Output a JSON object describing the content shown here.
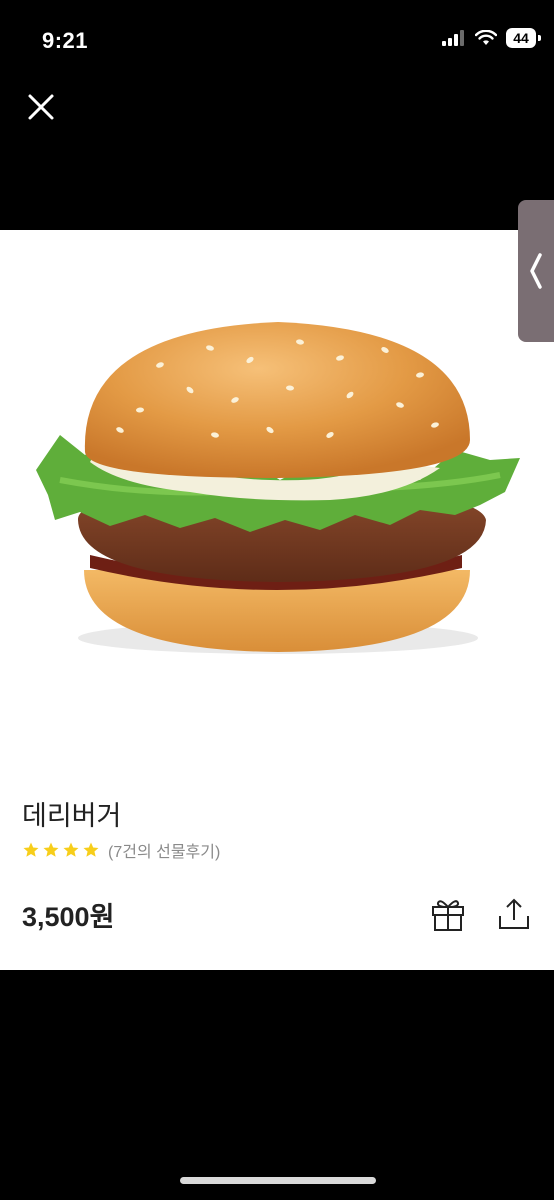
{
  "status_bar": {
    "time": "9:21",
    "battery": "44",
    "icons": [
      "signal-icon",
      "wifi-icon",
      "battery-icon"
    ]
  },
  "header": {
    "close_icon": "close-icon"
  },
  "image": {
    "subject": "burger-image"
  },
  "side_tab": {
    "icon": "chevron-left-icon"
  },
  "product": {
    "name": "데리버거",
    "rating": 4,
    "rating_max": 4,
    "reviews_label": "(7건의 선물후기)",
    "price": "3,500원"
  },
  "actions": {
    "gift_icon": "gift-icon",
    "share_icon": "share-icon"
  },
  "colors": {
    "star": "#F7CE1A",
    "background": "#000000",
    "card": "#FFFFFF"
  }
}
